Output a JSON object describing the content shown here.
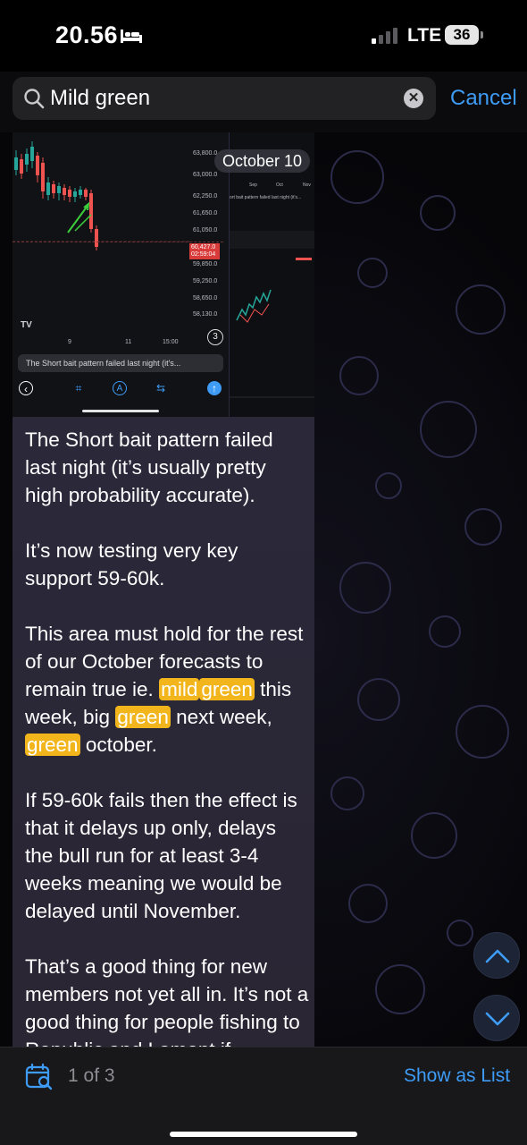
{
  "status_bar": {
    "time": "20.56",
    "network": "LTE",
    "battery": "36"
  },
  "search": {
    "query": "Mild green",
    "cancel_label": "Cancel"
  },
  "message": {
    "date_label": "October 10",
    "image": {
      "price_labels": [
        "63,800.0",
        "63,000.0",
        "62,250.0",
        "61,650.0",
        "61,050.0",
        "59,850.0",
        "59,250.0",
        "58,650.0",
        "58,130.0"
      ],
      "current_price": "60,427.0",
      "countdown": "02:59:04",
      "time_labels": [
        "9",
        "11",
        "15:00"
      ],
      "photo_count": "3",
      "caption_preview": "The Short bait pattern failed last night (it's...",
      "right_header": [
        "Sep",
        "Oct",
        "Nov"
      ],
      "right_caption": "ort bait pattern failed last night (it's..."
    },
    "paragraph_1": "The Short bait pattern failed last night (it’s usually pretty high probability accurate).",
    "paragraph_2": "It’s now testing very key support 59-60k.",
    "paragraph_3": {
      "t1": "This area must hold for the rest of our October forecasts to remain true ie.",
      "h1": "mild",
      "h2": "green",
      "t2": "this week, big",
      "h3": "green",
      "t3": "next week,",
      "h4": "green",
      "t4": "october."
    },
    "paragraph_4": "If 59-60k fails then the effect is that it delays up only, delays the bull run for at least 3-4 weeks meaning we would be delayed until November.",
    "paragraph_5": "That’s a good thing for new members not yet all in. It’s not a good thing for people fishing to Republic and Lamont if"
  },
  "bottom_bar": {
    "result_count": "1 of 3",
    "show_as_list": "Show as List"
  },
  "colors": {
    "accent": "#3e9cf6",
    "highlight": "#f2b51c",
    "bubble": "#2c2a3e",
    "candle_up": "#26a69a",
    "candle_down": "#ef5350"
  }
}
